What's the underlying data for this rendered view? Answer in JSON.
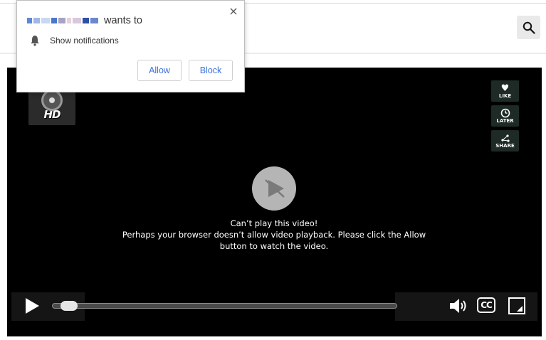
{
  "popup": {
    "site_suffix": "wants to",
    "permission": "Show notifications",
    "allow_label": "Allow",
    "block_label": "Block",
    "close_glyph": "×"
  },
  "header": {
    "search_icon": "search-icon"
  },
  "player": {
    "logo_text": "HD",
    "side_buttons": [
      {
        "label": "LIKE",
        "icon": "heart-icon"
      },
      {
        "label": "LATER",
        "icon": "clock-icon"
      },
      {
        "label": "SHARE",
        "icon": "share-icon"
      }
    ],
    "message_line1": "Can’t play this video!",
    "message_line2": "Perhaps your browser doesn’t allow video playback. Please click the Allow",
    "message_line3": "button to watch the video.",
    "cc_label": "CC",
    "progress": 0.05
  },
  "colors": {
    "accent": "#3b70d8",
    "player_bg": "#000000"
  }
}
